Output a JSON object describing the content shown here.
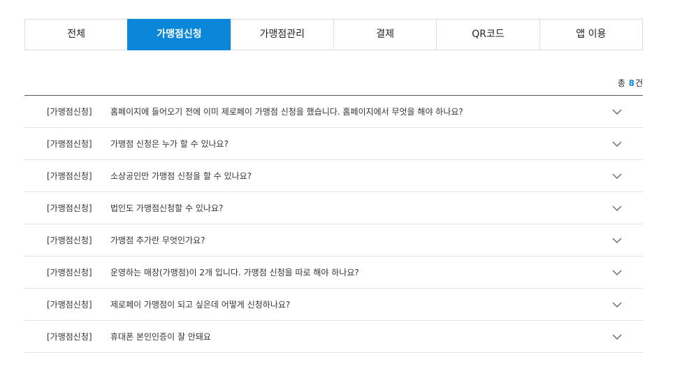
{
  "tabs": [
    {
      "label": "전체",
      "active": false
    },
    {
      "label": "가맹점신청",
      "active": true
    },
    {
      "label": "가맹점관리",
      "active": false
    },
    {
      "label": "결제",
      "active": false
    },
    {
      "label": "QR코드",
      "active": false
    },
    {
      "label": "앱 이용",
      "active": false
    }
  ],
  "count": {
    "prefix": "총",
    "value": "8",
    "suffix": "건"
  },
  "faq": [
    {
      "category": "[가맹점신청]",
      "question": "홈페이지에 들어오기 전에 이미 제로페이 가맹점 신청을 했습니다. 홈페이지에서 무엇을 해야 하나요?"
    },
    {
      "category": "[가맹점신청]",
      "question": "가맹점 신청은 누가 할 수 있나요?"
    },
    {
      "category": "[가맹점신청]",
      "question": "소상공인만 가맹점 신청을 할 수 있나요?"
    },
    {
      "category": "[가맹점신청]",
      "question": "법인도 가맹점신청할 수 있나요?"
    },
    {
      "category": "[가맹점신청]",
      "question": "가맹점 추가란 무엇인가요?"
    },
    {
      "category": "[가맹점신청]",
      "question": "운영하는 매장(가맹점)이 2개 입니다. 가맹점 신청을 따로 해야 하나요?"
    },
    {
      "category": "[가맹점신청]",
      "question": "제로페이 가맹점이 되고 싶은데 어떻게 신청하나요?"
    },
    {
      "category": "[가맹점신청]",
      "question": "휴대폰 본인인증이 잘 안돼요"
    }
  ],
  "icons": {
    "expand": "chevron-down-icon"
  },
  "colors": {
    "accent": "#0a87d9"
  }
}
